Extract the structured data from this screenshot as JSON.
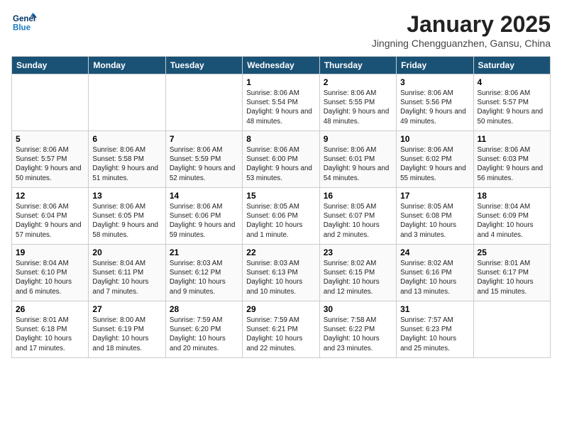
{
  "header": {
    "logo_line1": "General",
    "logo_line2": "Blue",
    "month_title": "January 2025",
    "subtitle": "Jingning Chengguanzhen, Gansu, China"
  },
  "weekdays": [
    "Sunday",
    "Monday",
    "Tuesday",
    "Wednesday",
    "Thursday",
    "Friday",
    "Saturday"
  ],
  "weeks": [
    [
      {
        "day": "",
        "detail": ""
      },
      {
        "day": "",
        "detail": ""
      },
      {
        "day": "",
        "detail": ""
      },
      {
        "day": "1",
        "detail": "Sunrise: 8:06 AM\nSunset: 5:54 PM\nDaylight: 9 hours\nand 48 minutes."
      },
      {
        "day": "2",
        "detail": "Sunrise: 8:06 AM\nSunset: 5:55 PM\nDaylight: 9 hours\nand 48 minutes."
      },
      {
        "day": "3",
        "detail": "Sunrise: 8:06 AM\nSunset: 5:56 PM\nDaylight: 9 hours\nand 49 minutes."
      },
      {
        "day": "4",
        "detail": "Sunrise: 8:06 AM\nSunset: 5:57 PM\nDaylight: 9 hours\nand 50 minutes."
      }
    ],
    [
      {
        "day": "5",
        "detail": "Sunrise: 8:06 AM\nSunset: 5:57 PM\nDaylight: 9 hours\nand 50 minutes."
      },
      {
        "day": "6",
        "detail": "Sunrise: 8:06 AM\nSunset: 5:58 PM\nDaylight: 9 hours\nand 51 minutes."
      },
      {
        "day": "7",
        "detail": "Sunrise: 8:06 AM\nSunset: 5:59 PM\nDaylight: 9 hours\nand 52 minutes."
      },
      {
        "day": "8",
        "detail": "Sunrise: 8:06 AM\nSunset: 6:00 PM\nDaylight: 9 hours\nand 53 minutes."
      },
      {
        "day": "9",
        "detail": "Sunrise: 8:06 AM\nSunset: 6:01 PM\nDaylight: 9 hours\nand 54 minutes."
      },
      {
        "day": "10",
        "detail": "Sunrise: 8:06 AM\nSunset: 6:02 PM\nDaylight: 9 hours\nand 55 minutes."
      },
      {
        "day": "11",
        "detail": "Sunrise: 8:06 AM\nSunset: 6:03 PM\nDaylight: 9 hours\nand 56 minutes."
      }
    ],
    [
      {
        "day": "12",
        "detail": "Sunrise: 8:06 AM\nSunset: 6:04 PM\nDaylight: 9 hours\nand 57 minutes."
      },
      {
        "day": "13",
        "detail": "Sunrise: 8:06 AM\nSunset: 6:05 PM\nDaylight: 9 hours\nand 58 minutes."
      },
      {
        "day": "14",
        "detail": "Sunrise: 8:06 AM\nSunset: 6:06 PM\nDaylight: 9 hours\nand 59 minutes."
      },
      {
        "day": "15",
        "detail": "Sunrise: 8:05 AM\nSunset: 6:06 PM\nDaylight: 10 hours\nand 1 minute."
      },
      {
        "day": "16",
        "detail": "Sunrise: 8:05 AM\nSunset: 6:07 PM\nDaylight: 10 hours\nand 2 minutes."
      },
      {
        "day": "17",
        "detail": "Sunrise: 8:05 AM\nSunset: 6:08 PM\nDaylight: 10 hours\nand 3 minutes."
      },
      {
        "day": "18",
        "detail": "Sunrise: 8:04 AM\nSunset: 6:09 PM\nDaylight: 10 hours\nand 4 minutes."
      }
    ],
    [
      {
        "day": "19",
        "detail": "Sunrise: 8:04 AM\nSunset: 6:10 PM\nDaylight: 10 hours\nand 6 minutes."
      },
      {
        "day": "20",
        "detail": "Sunrise: 8:04 AM\nSunset: 6:11 PM\nDaylight: 10 hours\nand 7 minutes."
      },
      {
        "day": "21",
        "detail": "Sunrise: 8:03 AM\nSunset: 6:12 PM\nDaylight: 10 hours\nand 9 minutes."
      },
      {
        "day": "22",
        "detail": "Sunrise: 8:03 AM\nSunset: 6:13 PM\nDaylight: 10 hours\nand 10 minutes."
      },
      {
        "day": "23",
        "detail": "Sunrise: 8:02 AM\nSunset: 6:15 PM\nDaylight: 10 hours\nand 12 minutes."
      },
      {
        "day": "24",
        "detail": "Sunrise: 8:02 AM\nSunset: 6:16 PM\nDaylight: 10 hours\nand 13 minutes."
      },
      {
        "day": "25",
        "detail": "Sunrise: 8:01 AM\nSunset: 6:17 PM\nDaylight: 10 hours\nand 15 minutes."
      }
    ],
    [
      {
        "day": "26",
        "detail": "Sunrise: 8:01 AM\nSunset: 6:18 PM\nDaylight: 10 hours\nand 17 minutes."
      },
      {
        "day": "27",
        "detail": "Sunrise: 8:00 AM\nSunset: 6:19 PM\nDaylight: 10 hours\nand 18 minutes."
      },
      {
        "day": "28",
        "detail": "Sunrise: 7:59 AM\nSunset: 6:20 PM\nDaylight: 10 hours\nand 20 minutes."
      },
      {
        "day": "29",
        "detail": "Sunrise: 7:59 AM\nSunset: 6:21 PM\nDaylight: 10 hours\nand 22 minutes."
      },
      {
        "day": "30",
        "detail": "Sunrise: 7:58 AM\nSunset: 6:22 PM\nDaylight: 10 hours\nand 23 minutes."
      },
      {
        "day": "31",
        "detail": "Sunrise: 7:57 AM\nSunset: 6:23 PM\nDaylight: 10 hours\nand 25 minutes."
      },
      {
        "day": "",
        "detail": ""
      }
    ]
  ]
}
